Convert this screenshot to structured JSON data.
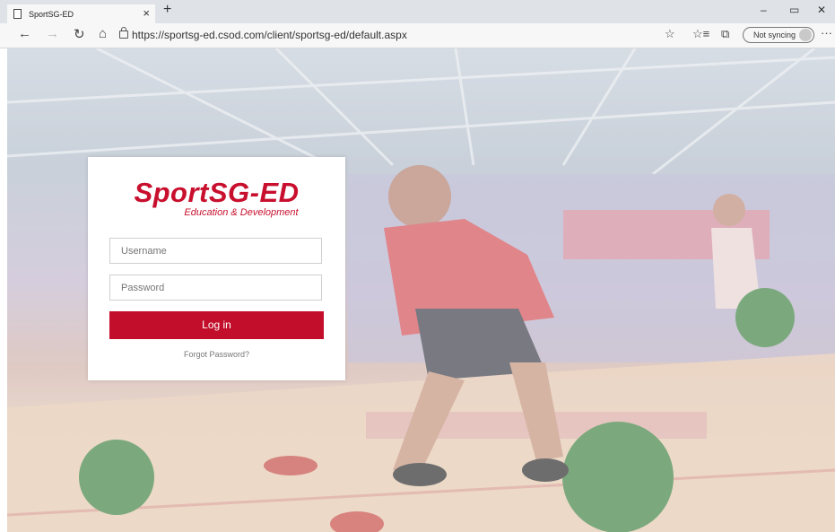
{
  "browser": {
    "tab_title": "SportSG-ED",
    "tab_close": "×",
    "new_tab": "+",
    "window_controls": {
      "minimize": "–",
      "restore": "▭",
      "close": "✕"
    },
    "nav": {
      "back": "←",
      "forward": "→",
      "refresh": "↻",
      "home": "⌂"
    },
    "url": "https://sportsg-ed.csod.com/client/sportsg-ed/default.aspx",
    "toolbar_icons": {
      "favorite": "☆",
      "favorites_list": "☆≡",
      "collections": "⧉",
      "more": "···"
    },
    "sync_label": "Not syncing"
  },
  "login": {
    "brand_main": "SportSG-ED",
    "brand_sub": "Education & Development",
    "username_placeholder": "Username",
    "password_placeholder": "Password",
    "login_button": "Log in",
    "forgot_link": "Forgot Password?"
  },
  "colors": {
    "brand_red": "#c8102e",
    "button_red": "#c20e2b"
  }
}
